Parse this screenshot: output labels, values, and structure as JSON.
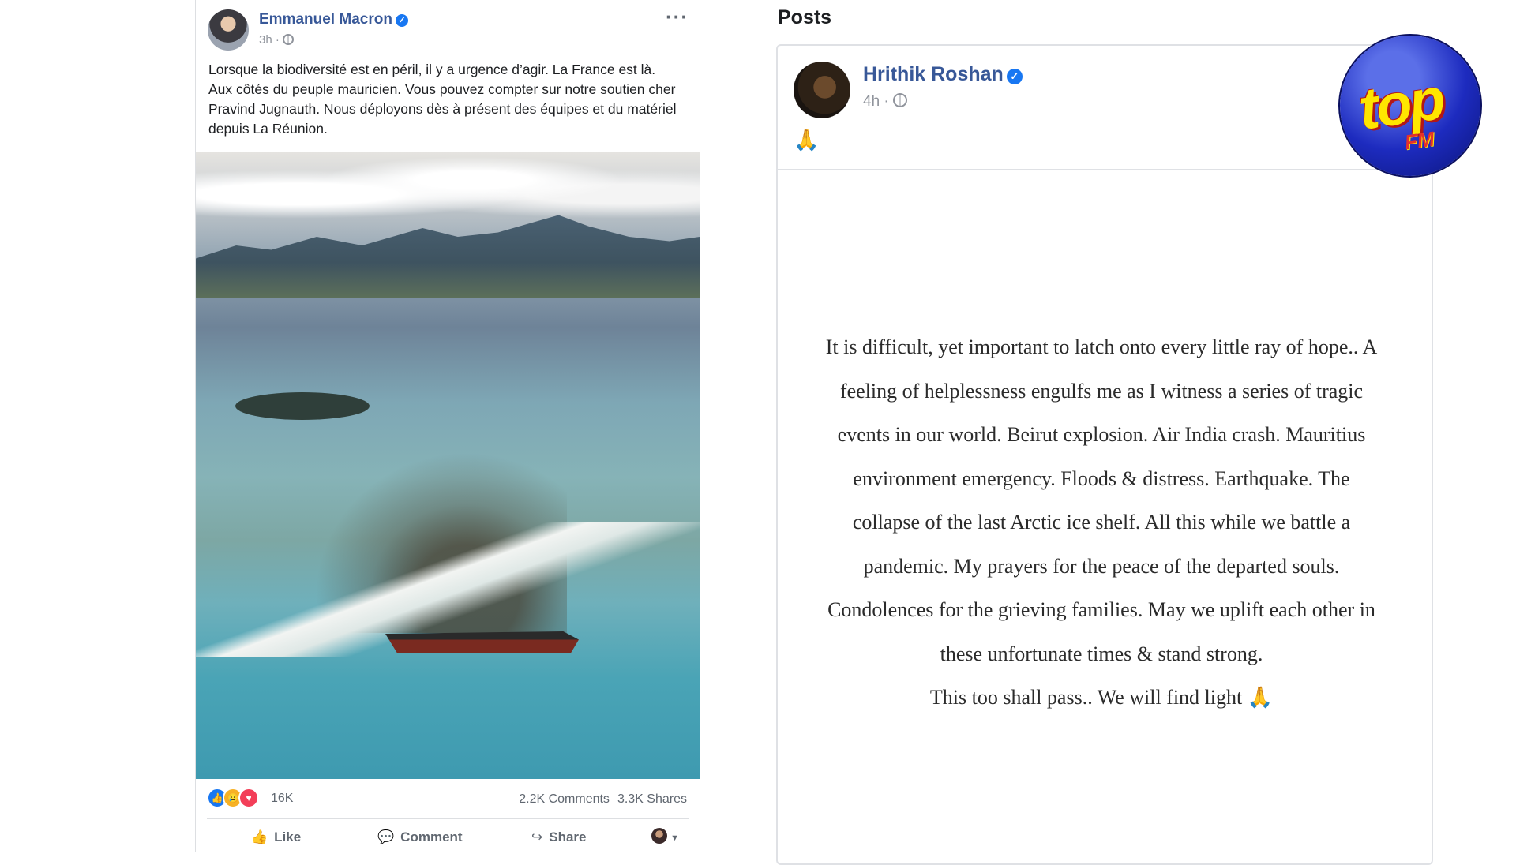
{
  "left_post": {
    "author": "Emmanuel Macron",
    "time": "3h ·",
    "text": "Lorsque la biodiversité est en péril, il y a urgence d’agir. La France est là. Aux côtés du peuple mauricien. Vous pouvez compter sur notre soutien cher Pravind Jugnauth. Nous déployons dès à présent des équipes et du matériel depuis La Réunion.",
    "reactions_count": "16K",
    "comments": "2.2K Comments",
    "shares": "3.3K Shares",
    "actions": {
      "like": "Like",
      "comment": "Comment",
      "share": "Share"
    }
  },
  "right_section": {
    "heading": "Posts",
    "author": "Hrithik Roshan",
    "time": "4h ·",
    "emoji": "🙏",
    "quote": "It is difficult, yet important to latch onto every little ray of hope.. A feeling of helplessness engulfs me as I witness a series of tragic events in our world. Beirut explosion. Air India crash. Mauritius environment emergency. Floods & distress. Earthquake. The collapse of the last Arctic ice shelf. All this while we battle a pandemic. My prayers for the peace of the departed souls. Condolences for the grieving families. May we uplift each other in these unfortunate times & stand strong.",
    "quote_last": "This too shall pass.. We will find light 🙏"
  },
  "logo": {
    "top": "top",
    "fm": "FM"
  },
  "colors": {
    "facebook_blue": "#385898",
    "verified": "#1877f2",
    "logo_yellow": "#ffe600",
    "logo_blue": "#1d2bbf"
  }
}
